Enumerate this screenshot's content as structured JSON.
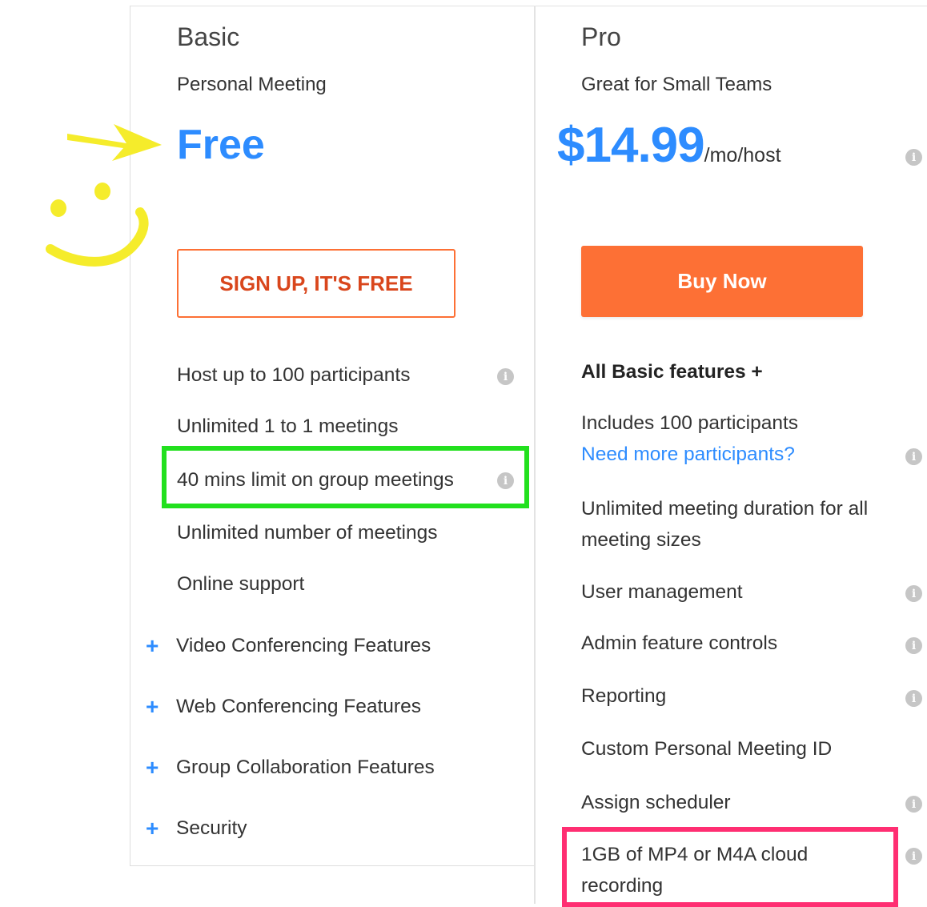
{
  "colors": {
    "accent": "#2d8cff",
    "link": "#2d8cff",
    "cta": "#fd7035",
    "highlight_green": "#22e01e",
    "highlight_pink": "#ff2e72",
    "doodle": "#f5ec2b"
  },
  "basic": {
    "name": "Basic",
    "tagline": "Personal Meeting",
    "price": "Free",
    "cta": "SIGN UP, IT'S FREE",
    "features": {
      "f1": "Host up to 100 participants",
      "f2": "Unlimited 1 to 1 meetings",
      "f3": "40 mins limit on group meetings",
      "f4": "Unlimited number of meetings",
      "f5": "Online support"
    },
    "expanders": {
      "e1": "Video Conferencing Features",
      "e2": "Web Conferencing Features",
      "e3": "Group Collaboration Features",
      "e4": "Security"
    }
  },
  "pro": {
    "name": "Pro",
    "tagline": "Great for Small Teams",
    "price": "$14.99",
    "price_unit": "/mo/host",
    "cta": "Buy Now",
    "features": {
      "header": "All Basic features +",
      "participants": "Includes 100 participants",
      "more_link": "Need more participants?",
      "duration": "Unlimited meeting duration for all meeting sizes",
      "user_mgmt": "User management",
      "admin": "Admin feature controls",
      "reporting": "Reporting",
      "pmi": "Custom Personal Meeting ID",
      "scheduler": "Assign scheduler",
      "recording": "1GB of MP4 or M4A cloud recording"
    }
  },
  "icons": {
    "info": "info-icon",
    "plus": "plus-icon",
    "info_glyph": "i",
    "plus_glyph": "+"
  }
}
